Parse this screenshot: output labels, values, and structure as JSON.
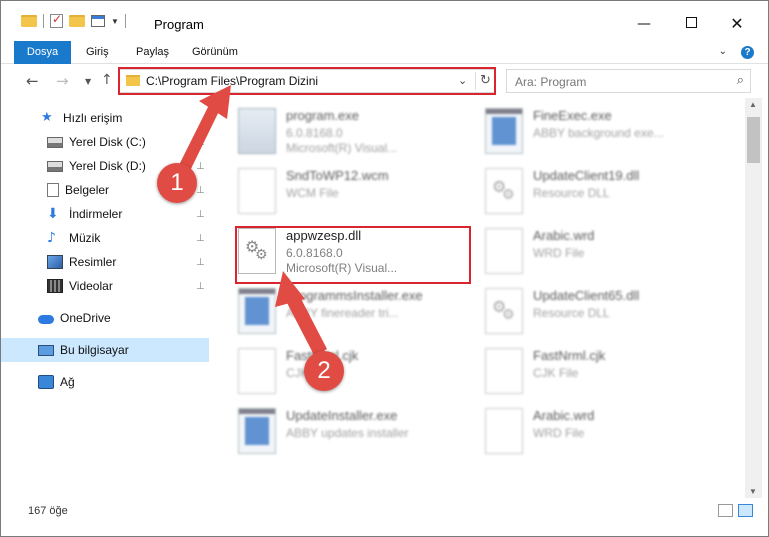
{
  "window": {
    "title": "Program",
    "controls": {
      "minimize": "—",
      "maximize": "",
      "close": "✕"
    }
  },
  "ribbon": {
    "tabs": [
      {
        "label": "Dosya",
        "active": true
      },
      {
        "label": "Giriş"
      },
      {
        "label": "Paylaş"
      },
      {
        "label": "Görünüm"
      }
    ],
    "expand": "⌄",
    "help": "?"
  },
  "nav": {
    "back": "←",
    "forward": "→",
    "history": "▼",
    "up": "↑",
    "address": "C:\\Program Files\\Program Dizini",
    "address_dropdown": "⌄",
    "refresh": "↻",
    "search_placeholder": "Ara: Program",
    "search_icon": "⌕"
  },
  "sidebar": {
    "items": [
      {
        "label": "Hızlı erişim",
        "icon": "star-icon",
        "pinned": false
      },
      {
        "label": "Yerel Disk (C:)",
        "icon": "drive-icon",
        "pinned": true
      },
      {
        "label": "Yerel Disk (D:)",
        "icon": "drive-icon",
        "pinned": true
      },
      {
        "label": "Belgeler",
        "icon": "documents-icon",
        "pinned": true
      },
      {
        "label": "İndirmeler",
        "icon": "download-icon",
        "pinned": true
      },
      {
        "label": "Müzik",
        "icon": "music-icon",
        "pinned": true
      },
      {
        "label": "Resimler",
        "icon": "pictures-icon",
        "pinned": true
      },
      {
        "label": "Videolar",
        "icon": "videos-icon",
        "pinned": true
      },
      {
        "label": "OneDrive",
        "icon": "onedrive-icon",
        "pinned": false
      },
      {
        "label": "Bu bilgisayar",
        "icon": "this-pc-icon",
        "pinned": false,
        "selected": true
      },
      {
        "label": "Ağ",
        "icon": "network-icon",
        "pinned": false
      }
    ],
    "pin_glyph": "📌"
  },
  "files": [
    {
      "name": "program.exe",
      "line1": "6.0.8168.0",
      "line2": "Microsoft(R) Visual...",
      "icon": "program-icon"
    },
    {
      "name": "FineExec.exe",
      "line1": "ABBY background exe...",
      "line2": "",
      "icon": "exe-icon"
    },
    {
      "name": "SndToWP12.wcm",
      "line1": "WCM File",
      "line2": "",
      "icon": "document-icon"
    },
    {
      "name": "UpdateClient19.dll",
      "line1": "Resource DLL",
      "line2": "",
      "icon": "dll-icon"
    },
    {
      "name": "appwzesp.dll",
      "line1": "6.0.8168.0",
      "line2": "Microsoft(R) Visual...",
      "icon": "dll-icon",
      "highlighted": true
    },
    {
      "name": "Arabic.wrd",
      "line1": "WRD File",
      "line2": "",
      "icon": "document-icon"
    },
    {
      "name": "ProgrammsInstaller.exe",
      "line1": "ABBY finereader tri...",
      "line2": "",
      "icon": "exe-icon"
    },
    {
      "name": "UpdateClient65.dll",
      "line1": "Resource DLL",
      "line2": "",
      "icon": "dll-icon"
    },
    {
      "name": "FastNrml.cjk",
      "line1": "CJK File",
      "line2": "",
      "icon": "document-icon"
    },
    {
      "name": "FastNrml.cjk",
      "line1": "CJK File",
      "line2": "",
      "icon": "document-icon"
    },
    {
      "name": "UpdateInstaller.exe",
      "line1": "ABBY updates installer",
      "line2": "",
      "icon": "exe-icon"
    },
    {
      "name": "Arabic.wrd",
      "line1": "WRD File",
      "line2": "",
      "icon": "document-icon"
    }
  ],
  "status": {
    "count": "167 öğe"
  },
  "annotations": {
    "badge1": "1",
    "badge2": "2",
    "color": "#e04b44"
  }
}
